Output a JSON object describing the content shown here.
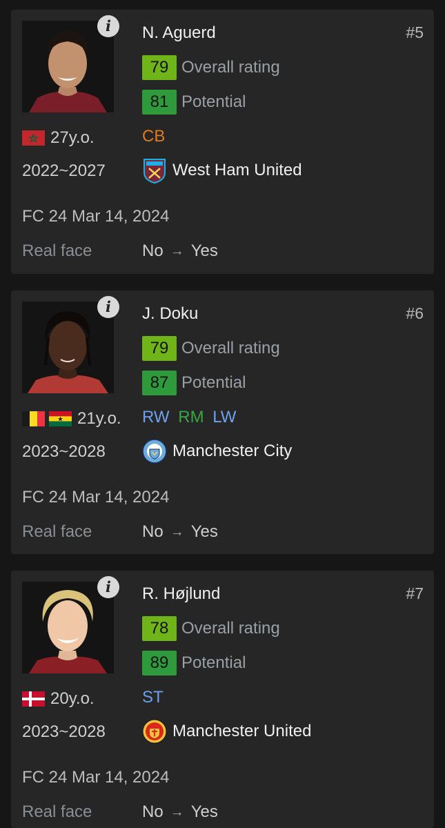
{
  "players": [
    {
      "name": "N. Aguerd",
      "rank": "#5",
      "overall": "79",
      "overall_label": "Overall rating",
      "overall_color": "#6fb51a",
      "potential": "81",
      "potential_label": "Potential",
      "potential_color": "#2e9a3c",
      "age": "27y.o.",
      "flags": [
        "morocco-flag"
      ],
      "positions": [
        {
          "label": "CB",
          "color": "#e07a1f"
        }
      ],
      "years": "2022~2027",
      "club": "West Ham United",
      "club_icon": "west-ham-crest-icon",
      "version": "FC 24 Mar 14, 2024",
      "real_face_label": "Real face",
      "real_face_from": "No",
      "real_face_to": "Yes"
    },
    {
      "name": "J. Doku",
      "rank": "#6",
      "overall": "79",
      "overall_label": "Overall rating",
      "overall_color": "#6fb51a",
      "potential": "87",
      "potential_label": "Potential",
      "potential_color": "#2e9a3c",
      "age": "21y.o.",
      "flags": [
        "belgium-flag",
        "ghana-flag"
      ],
      "positions": [
        {
          "label": "RW",
          "color": "#6fa0ee"
        },
        {
          "label": "RM",
          "color": "#39a844"
        },
        {
          "label": "LW",
          "color": "#6fa0ee"
        }
      ],
      "years": "2023~2028",
      "club": "Manchester City",
      "club_icon": "manchester-city-crest-icon",
      "version": "FC 24 Mar 14, 2024",
      "real_face_label": "Real face",
      "real_face_from": "No",
      "real_face_to": "Yes"
    },
    {
      "name": "R. Højlund",
      "rank": "#7",
      "overall": "78",
      "overall_label": "Overall rating",
      "overall_color": "#6fb51a",
      "potential": "89",
      "potential_label": "Potential",
      "potential_color": "#2e9a3c",
      "age": "20y.o.",
      "flags": [
        "denmark-flag"
      ],
      "positions": [
        {
          "label": "ST",
          "color": "#6fa0ee"
        }
      ],
      "years": "2023~2028",
      "club": "Manchester United",
      "club_icon": "manchester-united-crest-icon",
      "version": "FC 24 Mar 14, 2024",
      "real_face_label": "Real face",
      "real_face_from": "No",
      "real_face_to": "Yes"
    }
  ]
}
